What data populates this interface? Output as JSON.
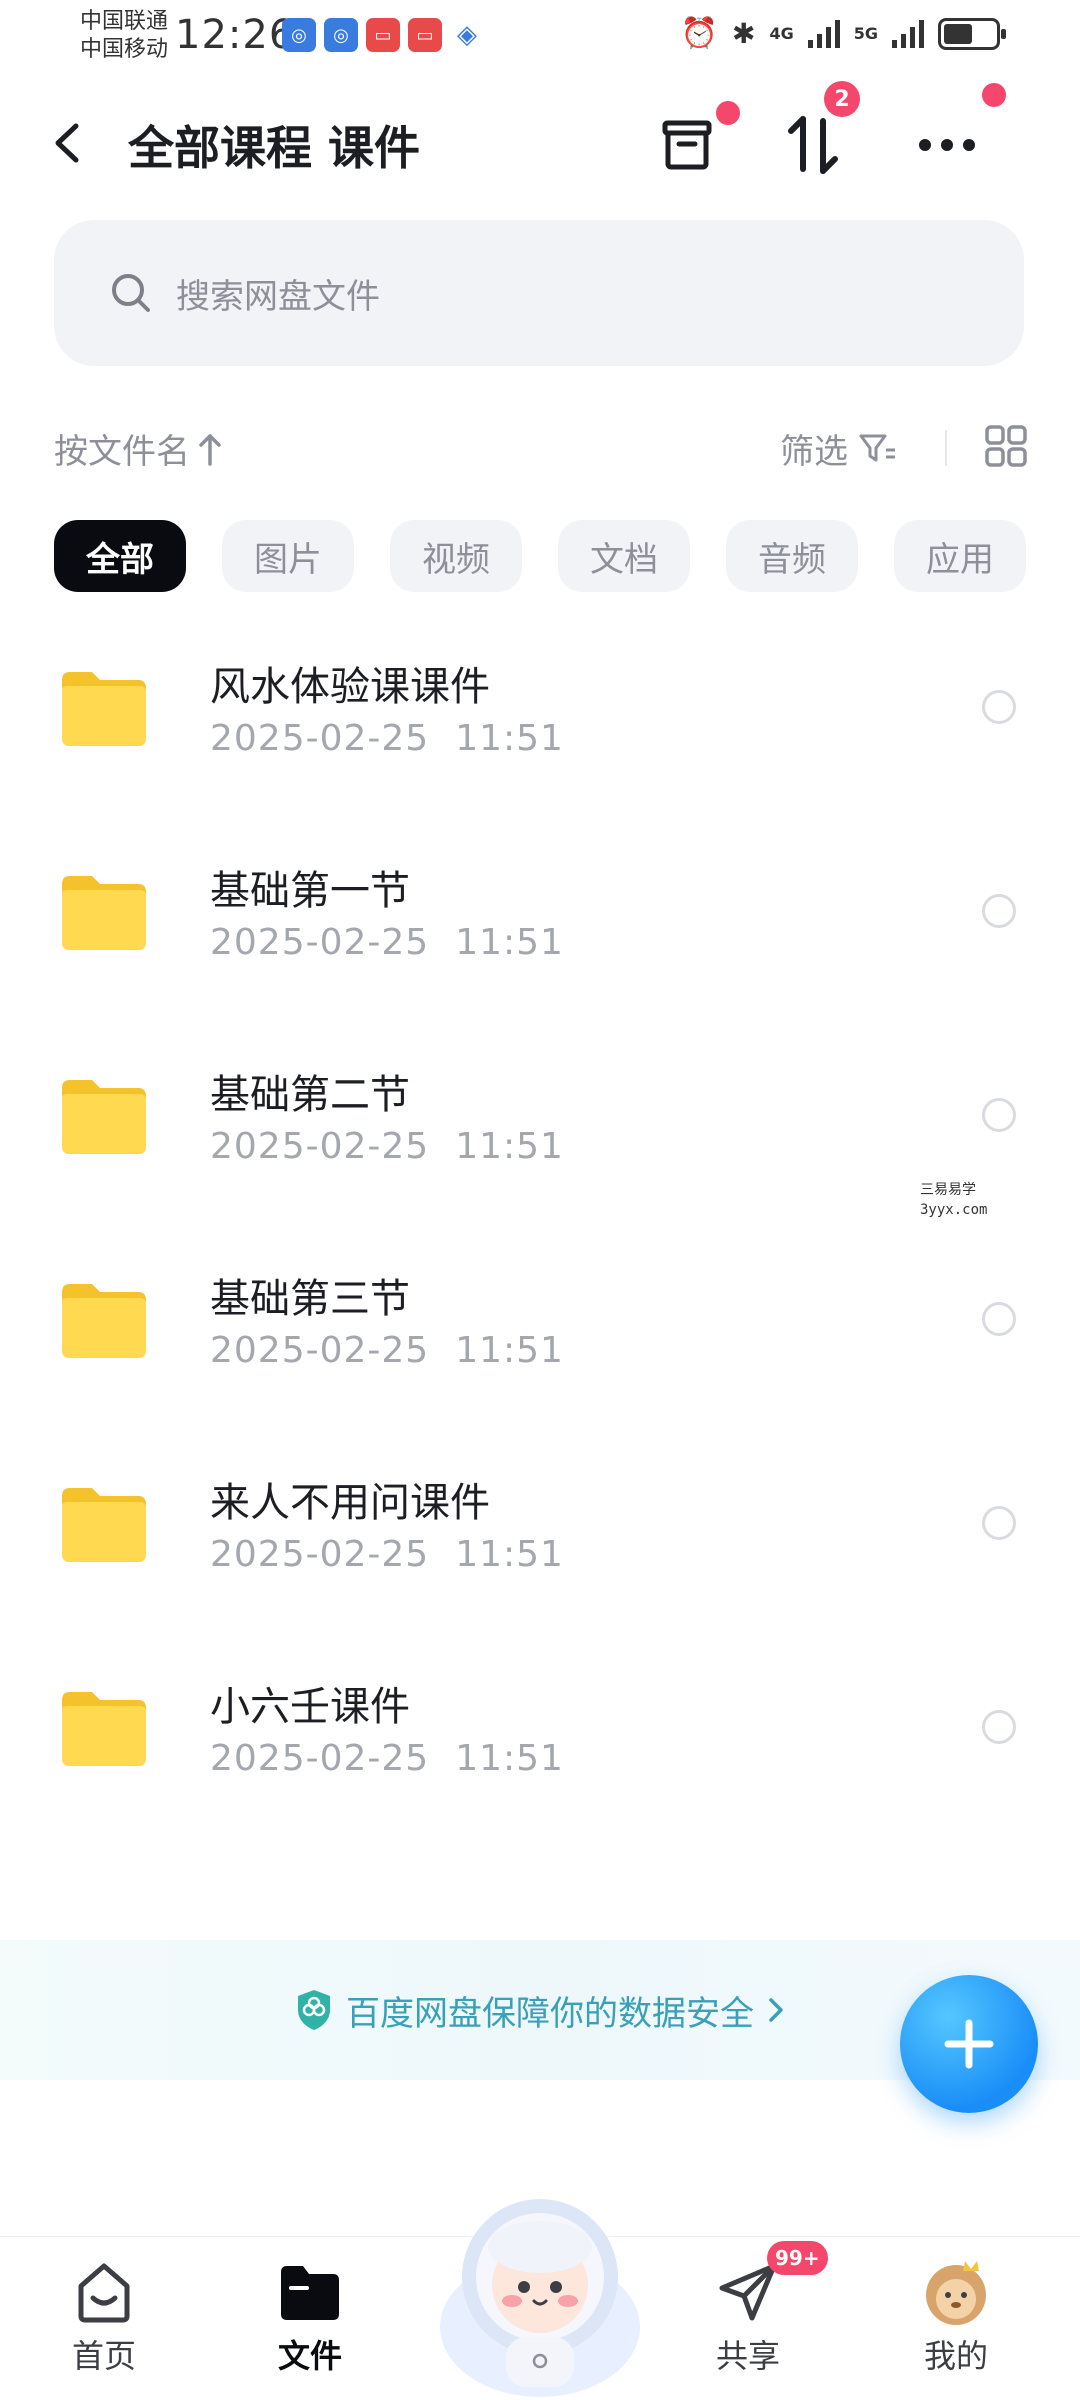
{
  "status_bar": {
    "carrier_1": "中国联通",
    "carrier_2": "中国移动",
    "time": "12:26",
    "network_1": "4G",
    "network_2": "5G",
    "battery_level": 0.55
  },
  "header": {
    "title": "全部课程 课件",
    "transfer_badge": "2"
  },
  "search": {
    "placeholder": "搜索网盘文件"
  },
  "toolbar": {
    "sort_label": "按文件名",
    "filter_label": "筛选"
  },
  "chips": [
    {
      "label": "全部",
      "active": true
    },
    {
      "label": "图片",
      "active": false
    },
    {
      "label": "视频",
      "active": false
    },
    {
      "label": "文档",
      "active": false
    },
    {
      "label": "音频",
      "active": false
    },
    {
      "label": "应用",
      "active": false
    }
  ],
  "files": [
    {
      "name": "风水体验课课件",
      "date": "2025-02-25",
      "time": "11:51"
    },
    {
      "name": "基础第一节",
      "date": "2025-02-25",
      "time": "11:51"
    },
    {
      "name": "基础第二节",
      "date": "2025-02-25",
      "time": "11:51"
    },
    {
      "name": "基础第三节",
      "date": "2025-02-25",
      "time": "11:51"
    },
    {
      "name": "来人不用问课件",
      "date": "2025-02-25",
      "time": "11:51"
    },
    {
      "name": "小六壬课件",
      "date": "2025-02-25",
      "time": "11:51"
    }
  ],
  "watermark": {
    "line1": "三易易学",
    "line2": "3yyx.com"
  },
  "banner": {
    "text": "百度网盘保障你的数据安全"
  },
  "bottom_nav": {
    "home": "首页",
    "files": "文件",
    "share": "共享",
    "share_badge": "99+",
    "mine": "我的"
  },
  "colors": {
    "accent": "#1a8ef7",
    "badge": "#f5466b",
    "folder": "#ffd54a",
    "banner_text": "#3aa0b8"
  }
}
